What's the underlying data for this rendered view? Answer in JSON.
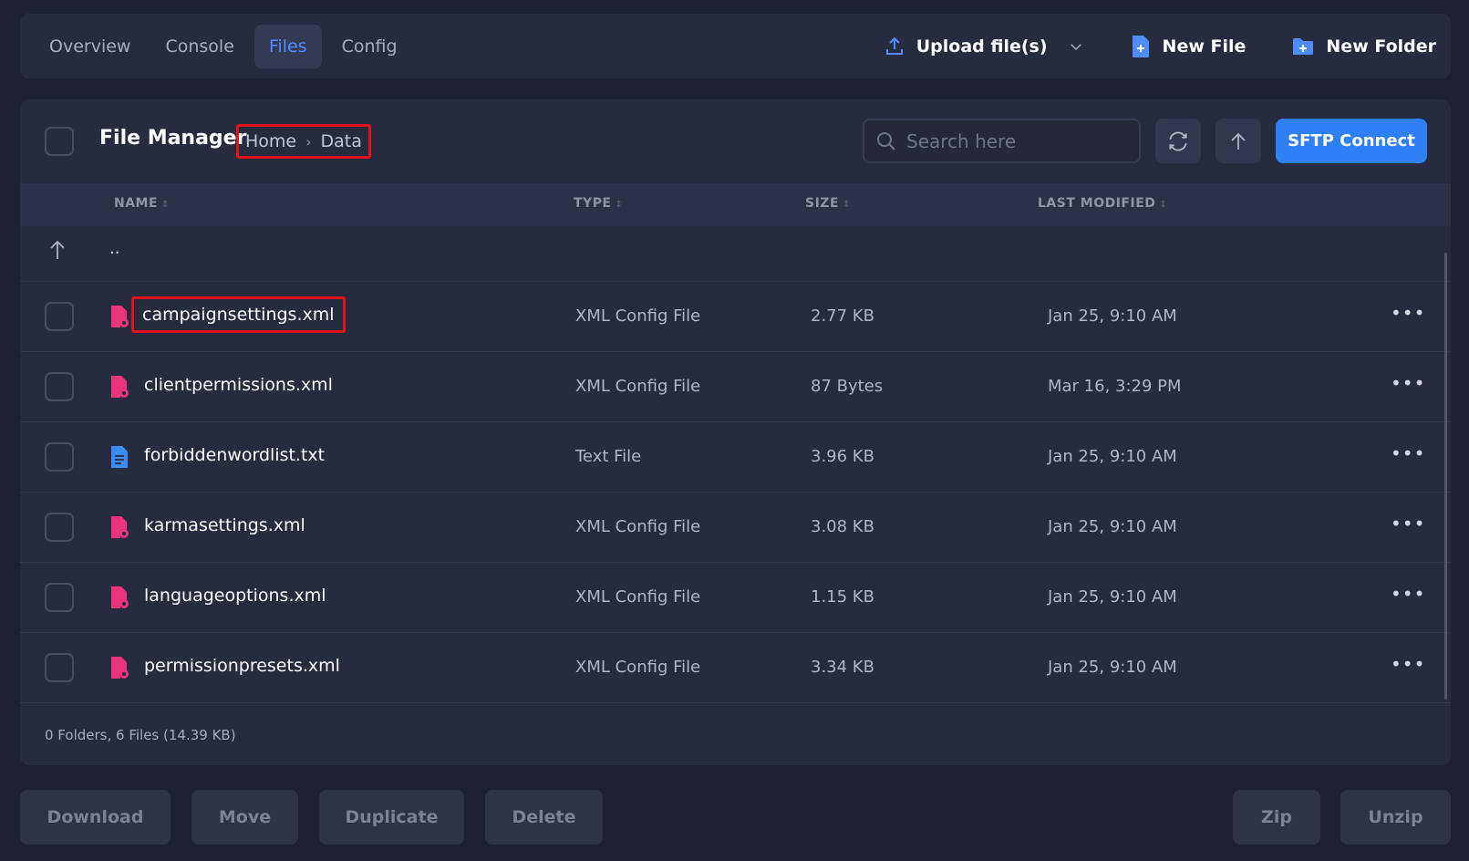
{
  "nav": {
    "tabs": [
      {
        "label": "Overview"
      },
      {
        "label": "Console"
      },
      {
        "label": "Files",
        "active": true
      },
      {
        "label": "Config"
      }
    ],
    "upload_label": "Upload file(s)",
    "new_file_label": "New File",
    "new_folder_label": "New Folder"
  },
  "file_manager": {
    "title": "File Manager",
    "breadcrumb": [
      "Home",
      "Data"
    ],
    "search_placeholder": "Search here",
    "sftp_label": "SFTP Connect",
    "columns": {
      "name": "NAME",
      "type": "TYPE",
      "size": "SIZE",
      "modified": "LAST MODIFIED"
    },
    "parent_label": "..",
    "files": [
      {
        "name": "campaignsettings.xml",
        "type": "XML Config File",
        "size": "2.77 KB",
        "modified": "Jan 25, 9:10 AM",
        "icon": "xml-config-file-icon"
      },
      {
        "name": "clientpermissions.xml",
        "type": "XML Config File",
        "size": "87 Bytes",
        "modified": "Mar 16, 3:29 PM",
        "icon": "xml-config-file-icon"
      },
      {
        "name": "forbiddenwordlist.txt",
        "type": "Text File",
        "size": "3.96 KB",
        "modified": "Jan 25, 9:10 AM",
        "icon": "text-file-icon"
      },
      {
        "name": "karmasettings.xml",
        "type": "XML Config File",
        "size": "3.08 KB",
        "modified": "Jan 25, 9:10 AM",
        "icon": "xml-config-file-icon"
      },
      {
        "name": "languageoptions.xml",
        "type": "XML Config File",
        "size": "1.15 KB",
        "modified": "Jan 25, 9:10 AM",
        "icon": "xml-config-file-icon"
      },
      {
        "name": "permissionpresets.xml",
        "type": "XML Config File",
        "size": "3.34 KB",
        "modified": "Jan 25, 9:10 AM",
        "icon": "xml-config-file-icon"
      }
    ],
    "summary": "0 Folders, 6 Files (14.39 KB)"
  },
  "bottom_actions": {
    "download": "Download",
    "move": "Move",
    "duplicate": "Duplicate",
    "delete": "Delete",
    "zip": "Zip",
    "unzip": "Unzip"
  },
  "colors": {
    "accent": "#2f7ff5",
    "xml_icon": "#e8347a",
    "text_icon": "#3b8cf0",
    "highlight_box": "#e0121b"
  }
}
